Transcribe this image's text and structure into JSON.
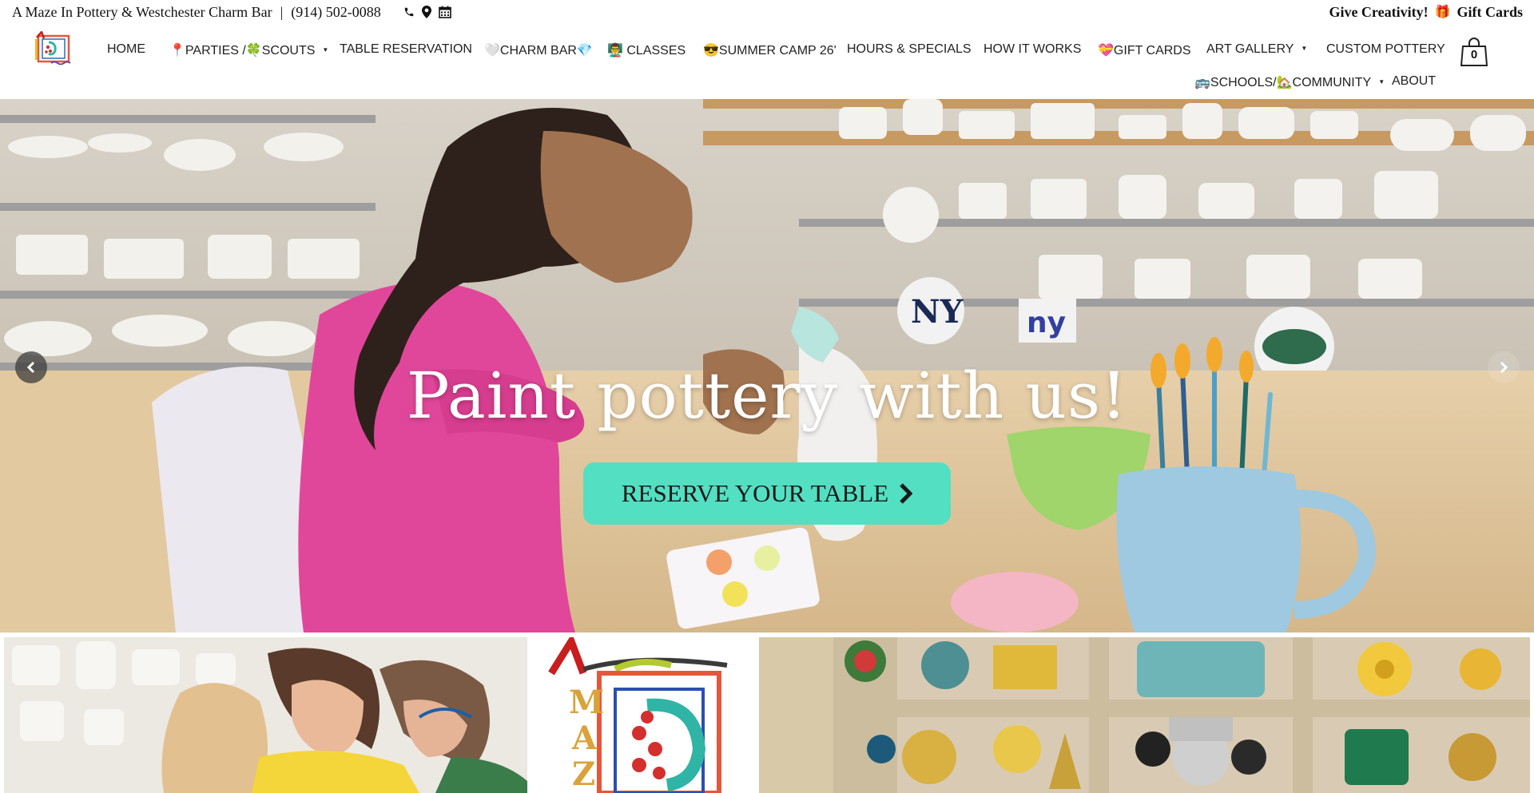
{
  "topbar": {
    "business_name": "A Maze In Pottery & Westchester Charm Bar",
    "separator": "|",
    "phone": "(914) 502-0088",
    "icons": [
      "phone-icon",
      "map-pin-icon",
      "calendar-icon"
    ],
    "give_creativity": "Give Creativity!",
    "gift_emoji": "🎁",
    "gift_cards_link": "Gift Cards"
  },
  "nav": {
    "logo_alt": "A Maze In Pottery logo",
    "items": [
      {
        "label": "HOME"
      },
      {
        "label": "📍PARTIES /🍀SCOUTS",
        "dropdown": true
      },
      {
        "label": "TABLE RESERVATION"
      },
      {
        "label": "🤍CHARM BAR💎"
      },
      {
        "label": "👨‍🏫 CLASSES"
      },
      {
        "label": "😎SUMMER CAMP 26'"
      },
      {
        "label": "HOURS & SPECIALS"
      },
      {
        "label": "HOW IT WORKS"
      },
      {
        "label": "💝GIFT CARDS"
      },
      {
        "label": "ART GALLERY",
        "dropdown": true
      },
      {
        "label": "CUSTOM POTTERY"
      },
      {
        "label": "🚌SCHOOLS/🏡COMMUNITY",
        "dropdown": true
      },
      {
        "label": "ABOUT"
      }
    ],
    "cart_count": "0",
    "caret": "▼"
  },
  "hero": {
    "title": "Paint pottery with us!",
    "cta_label": "RESERVE YOUR TABLE",
    "cta_color": "#53dfc2"
  },
  "colors": {
    "accent": "#53dfc2",
    "nav_border": "#5f8fa8",
    "hoodie_pink": "#e0479a"
  }
}
